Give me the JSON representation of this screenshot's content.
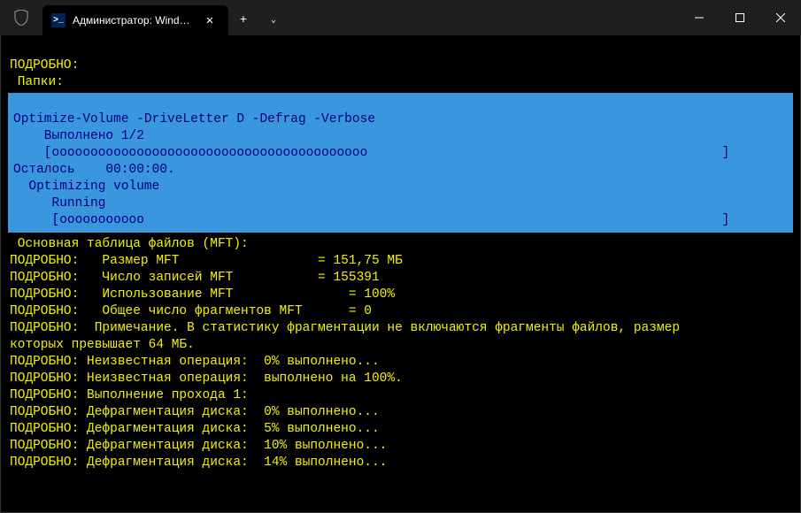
{
  "titlebar": {
    "tab_title": "Администратор: Windows Po",
    "tab_close": "✕",
    "newtab": "+",
    "dropdown": "⌄",
    "minimize": "—",
    "maximize": "□",
    "close": "✕"
  },
  "header": {
    "verbose_label": "ПОДРОБНО:",
    "folders_label": " Папки:"
  },
  "progress": {
    "command": "Optimize-Volume -DriveLetter D -Defrag -Verbose",
    "done_label": "    Выполнено 1/2",
    "bar1_open": "    [",
    "bar1_fill": "ooooooooooooooooooooooooooooooooooooooooo",
    "bar1_close": "                                              ]",
    "remaining": "Осталось    00:00:00.",
    "optimizing": "  Optimizing volume",
    "running": "     Running",
    "bar2_open": "     [",
    "bar2_fill": "ooooooooooo",
    "bar2_close": "                                                                           ]"
  },
  "output": {
    "mft_header": " Основная таблица файлов (MFT):",
    "mft_size": "ПОДРОБНО:   Размер MFT                  = 151,75 МБ",
    "mft_records": "ПОДРОБНО:   Число записей MFT           = 155391",
    "mft_usage": "ПОДРОБНО:   Использование MFT               = 100%",
    "mft_fragments": "ПОДРОБНО:   Общее число фрагментов MFT      = 0",
    "note1": "ПОДРОБНО:  Примечание. В статистику фрагментации не включаются фрагменты файлов, размер",
    "note2": "которых превышает 64 МБ.",
    "unknown0": "ПОДРОБНО: Неизвестная операция:  0% выполнено...",
    "unknown100": "ПОДРОБНО: Неизвестная операция:  выполнено на 100%.",
    "pass1": "ПОДРОБНО: Выполнение прохода 1:",
    "defrag0": "ПОДРОБНО: Дефрагментация диска:  0% выполнено...",
    "defrag5": "ПОДРОБНО: Дефрагментация диска:  5% выполнено...",
    "defrag10": "ПОДРОБНО: Дефрагментация диска:  10% выполнено...",
    "defrag14": "ПОДРОБНО: Дефрагментация диска:  14% выполнено..."
  }
}
